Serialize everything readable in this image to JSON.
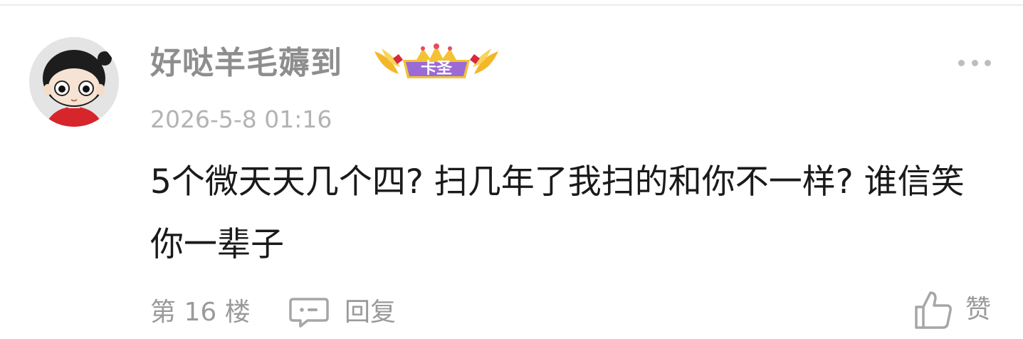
{
  "comment": {
    "username": "好哒羊毛薅到",
    "badge": {
      "label": "卡圣",
      "icon": "crown-badge-icon",
      "color": "#9b6ad6"
    },
    "timestamp": "2026-5-8 01:16",
    "text": "5个微天天几个四? 扫几年了我扫的和你不一样? 谁信笑你一辈子",
    "floor_label": "第 16 楼",
    "reply_label": "回复",
    "like_label": "赞",
    "more_icon": "more-dots-icon",
    "reply_icon": "comment-bubble-icon",
    "like_icon": "thumbs-up-icon",
    "avatar_icon": "cartoon-avatar-icon"
  }
}
